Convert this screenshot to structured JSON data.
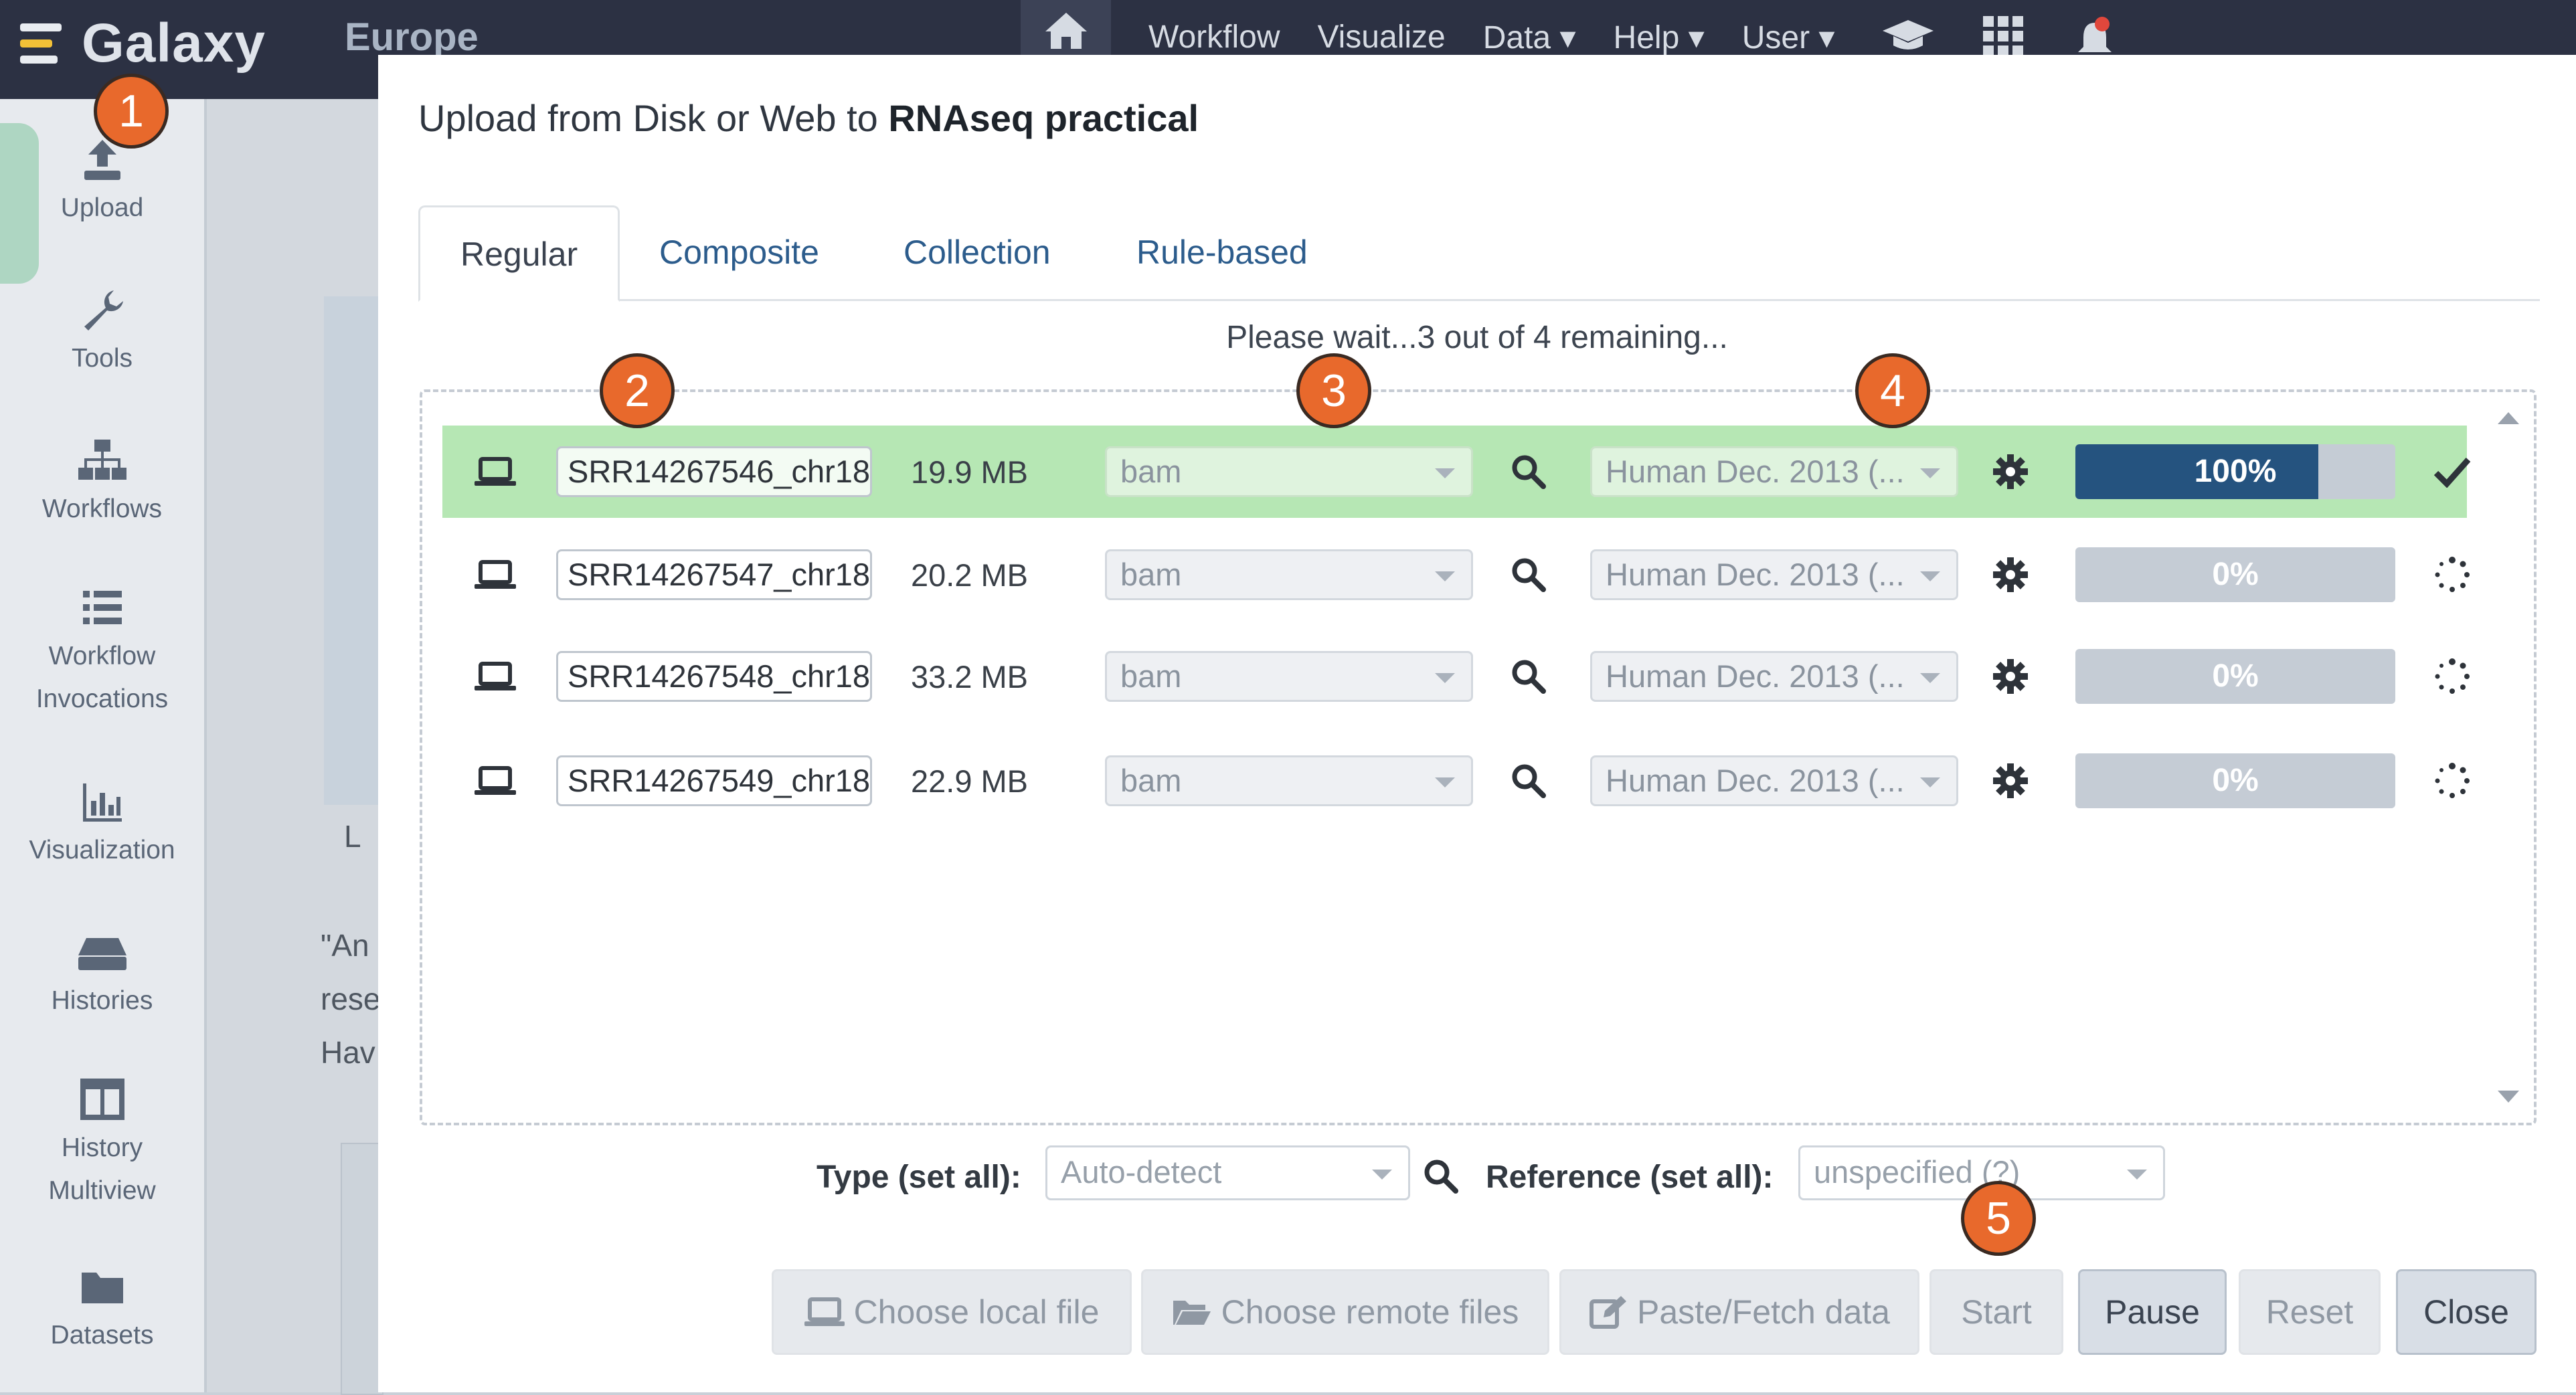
{
  "navbar": {
    "brand": "Galaxy",
    "subtitle": "Europe",
    "items": [
      "Workflow",
      "Visualize",
      "Data",
      "Help",
      "User"
    ],
    "dropdown_flags": [
      false,
      false,
      true,
      true,
      true
    ]
  },
  "sidebar": {
    "items": [
      {
        "label": "Upload",
        "icon": "upload-icon"
      },
      {
        "label": "Tools",
        "icon": "wrench-icon"
      },
      {
        "label": "Workflows",
        "icon": "sitemap-icon"
      },
      {
        "label": "Workflow Invocations",
        "icon": "list-icon"
      },
      {
        "label": "Visualization",
        "icon": "bar-chart-icon"
      },
      {
        "label": "Histories",
        "icon": "hdd-icon"
      },
      {
        "label": "History Multiview",
        "icon": "columns-icon"
      },
      {
        "label": "Datasets",
        "icon": "folder-icon"
      }
    ]
  },
  "background_page": {
    "letter": "L",
    "quote_lines": [
      "\"An",
      "rese",
      "Hav"
    ]
  },
  "upload_dialog": {
    "title_prefix": "Upload from Disk or Web to",
    "history_name": "RNAseq practical",
    "tabs": [
      "Regular",
      "Composite",
      "Collection",
      "Rule-based"
    ],
    "active_tab": "Regular",
    "status": "Please wait...3 out of 4 remaining...",
    "files": [
      {
        "name": "SRR14267546_chr18",
        "size": "19.9 MB",
        "type": "bam",
        "reference": "Human Dec. 2013 (...",
        "progress": "100%",
        "progress_fraction": 0.76,
        "state": "done"
      },
      {
        "name": "SRR14267547_chr18",
        "size": "20.2 MB",
        "type": "bam",
        "reference": "Human Dec. 2013 (...",
        "progress": "0%",
        "progress_fraction": 0.0,
        "state": "queued"
      },
      {
        "name": "SRR14267548_chr18",
        "size": "33.2 MB",
        "type": "bam",
        "reference": "Human Dec. 2013 (...",
        "progress": "0%",
        "progress_fraction": 0.0,
        "state": "queued"
      },
      {
        "name": "SRR14267549_chr18",
        "size": "22.9 MB",
        "type": "bam",
        "reference": "Human Dec. 2013 (...",
        "progress": "0%",
        "progress_fraction": 0.0,
        "state": "queued"
      }
    ],
    "set_all": {
      "type_label": "Type (set all):",
      "type_value": "Auto-detect",
      "reference_label": "Reference (set all):",
      "reference_value": "unspecified (?)"
    },
    "buttons": {
      "choose_local": "Choose local file",
      "choose_remote": "Choose remote files",
      "paste_fetch": "Paste/Fetch data",
      "start": "Start",
      "pause": "Pause",
      "reset": "Reset",
      "close": "Close"
    }
  },
  "callouts": [
    "1",
    "2",
    "3",
    "4",
    "5"
  ],
  "colors": {
    "navbar": "#2c3143",
    "progress_fill": "#25537f",
    "done_row": "#b6e7b4",
    "callout": "#e8692c"
  }
}
